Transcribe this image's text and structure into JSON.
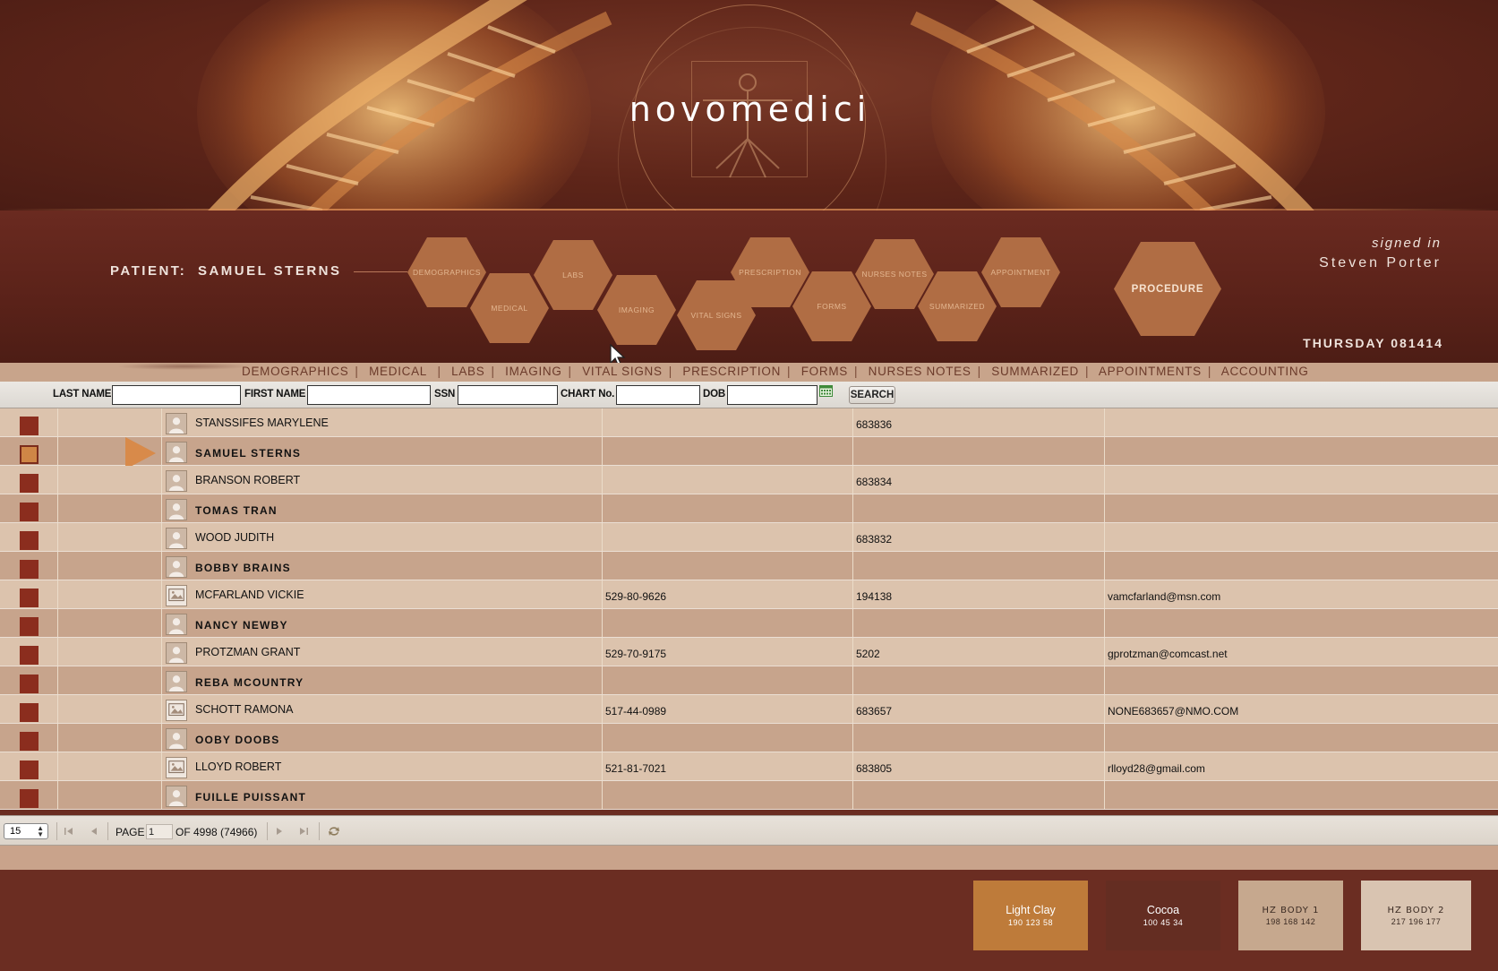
{
  "brand": {
    "logo": "novomedici"
  },
  "patient": {
    "label": "PATIENT",
    "name": "SAMUEL STERNS"
  },
  "hex_nav": [
    "DEMOGRAPHICS",
    "MEDICAL",
    "LABS",
    "IMAGING",
    "VITAL SIGNS",
    "PRESCRIPTION",
    "FORMS",
    "NURSES NOTES",
    "SUMMARIZED",
    "APPOINTMENT",
    "PROCEDURE"
  ],
  "session": {
    "signed_in_label": "signed in",
    "user": "Steven Porter",
    "date": "THURSDAY 081414"
  },
  "menu": [
    "DEMOGRAPHICS",
    "MEDICAL",
    "LABS",
    "IMAGING",
    "VITAL SIGNS",
    "PRESCRIPTION",
    "FORMS",
    "NURSES NOTES",
    "SUMMARIZED",
    "APPOINTMENTS",
    "ACCOUNTING"
  ],
  "search": {
    "last_name_label": "LAST NAME",
    "last_name_value": "",
    "first_name_label": "FIRST NAME",
    "first_name_value": "",
    "ssn_label": "SSN",
    "ssn_value": "",
    "chart_label": "CHART No.",
    "chart_value": "",
    "dob_label": "DOB",
    "dob_value": "",
    "button": "SEARCH"
  },
  "patients": [
    {
      "name": "STANSSIFES MARYLENE",
      "ssn": "",
      "chart": "683836",
      "email": "",
      "bold": false,
      "selected": false,
      "avatar": "person-icon"
    },
    {
      "name": "SAMUEL STERNS",
      "ssn": "",
      "chart": "",
      "email": "",
      "bold": true,
      "selected": true,
      "avatar": "person-icon"
    },
    {
      "name": "BRANSON ROBERT",
      "ssn": "",
      "chart": "683834",
      "email": "",
      "bold": false,
      "selected": false,
      "avatar": "person-icon"
    },
    {
      "name": "TOMAS TRAN",
      "ssn": "",
      "chart": "",
      "email": "",
      "bold": true,
      "selected": false,
      "avatar": "person-icon"
    },
    {
      "name": "WOOD JUDITH",
      "ssn": "",
      "chart": "683832",
      "email": "",
      "bold": false,
      "selected": false,
      "avatar": "person-icon"
    },
    {
      "name": "BOBBY BRAINS",
      "ssn": "",
      "chart": "",
      "email": "",
      "bold": true,
      "selected": false,
      "avatar": "person-icon"
    },
    {
      "name": "MCFARLAND VICKIE",
      "ssn": "529-80-9626",
      "chart": "194138",
      "email": "vamcfarland@msn.com",
      "bold": false,
      "selected": false,
      "avatar": "photo-icon"
    },
    {
      "name": "NANCY NEWBY",
      "ssn": "",
      "chart": "",
      "email": "",
      "bold": true,
      "selected": false,
      "avatar": "person-icon"
    },
    {
      "name": "PROTZMAN GRANT",
      "ssn": "529-70-9175",
      "chart": "5202",
      "email": "gprotzman@comcast.net",
      "bold": false,
      "selected": false,
      "avatar": "person-icon"
    },
    {
      "name": "REBA MCOUNTRY",
      "ssn": "",
      "chart": "",
      "email": "",
      "bold": true,
      "selected": false,
      "avatar": "person-icon"
    },
    {
      "name": "SCHOTT RAMONA",
      "ssn": "517-44-0989",
      "chart": "683657",
      "email": "NONE683657@NMO.COM",
      "bold": false,
      "selected": false,
      "avatar": "photo-icon"
    },
    {
      "name": "OOBY DOOBS",
      "ssn": "",
      "chart": "",
      "email": "",
      "bold": true,
      "selected": false,
      "avatar": "person-icon"
    },
    {
      "name": "LLOYD ROBERT",
      "ssn": "521-81-7021",
      "chart": "683805",
      "email": "rlloyd28@gmail.com",
      "bold": false,
      "selected": false,
      "avatar": "photo-icon"
    },
    {
      "name": "FUILLE PUISSANT",
      "ssn": "",
      "chart": "",
      "email": "",
      "bold": true,
      "selected": false,
      "avatar": "person-icon"
    }
  ],
  "pager": {
    "page_size": "15",
    "page_label": "PAGE",
    "page_value": "1",
    "of_text": "OF 4998 (74966)"
  },
  "swatches": [
    {
      "name": "Light Clay",
      "value": "190 123 58",
      "color": "#be7b3a"
    },
    {
      "name": "Cocoa",
      "value": "100 45 34",
      "color": "#642d22"
    },
    {
      "name": "HZ BODY 1",
      "value": "198 168 142",
      "color": "#c6a88e"
    },
    {
      "name": "HZ BODY 2",
      "value": "217 196 177",
      "color": "#d9c4b1"
    }
  ],
  "colors": {
    "brand_dark": "#6b2d22",
    "accent_orange": "#be7b3a",
    "row_light": "#dcc3ad",
    "row_dark": "#c7a48c",
    "status_marker": "#8b2d1e"
  }
}
